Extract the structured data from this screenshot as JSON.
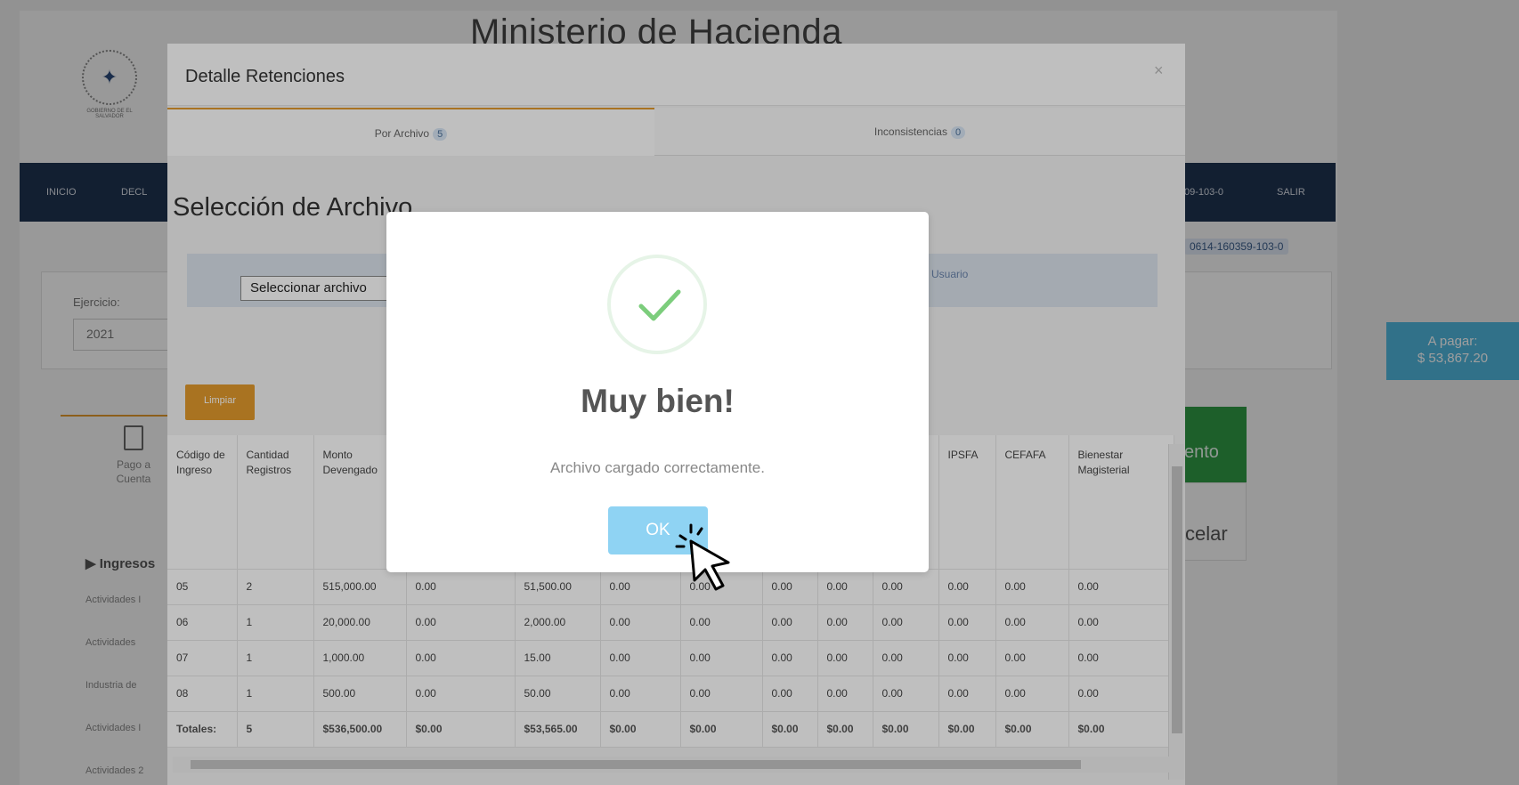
{
  "site": {
    "title": "Ministerio de Hacienda",
    "logo_caption": "GOBIERNO DE EL SALVADOR",
    "nav": [
      "INICIO",
      "DECL",
      "09-103-0",
      "SALIR"
    ],
    "nit_badge": "0614-160359-103-0",
    "ejercicio_label": "Ejercicio:",
    "ejercicio_value": "2021",
    "apagar_label": "A pagar:",
    "apagar_value": "$ 53,867.20",
    "green_btn_text": "ento",
    "cancel_btn_text": "celar",
    "tab_pago_line1": "Pago a",
    "tab_pago_line2": "Cuenta",
    "ingresos_label": "Ingresos",
    "side_rows": [
      "Actividades I",
      "Actividades",
      "Industria de",
      "Actividades I",
      "Actividades 2"
    ]
  },
  "detalle": {
    "title": "Detalle Retenciones",
    "close": "×",
    "tabs": [
      {
        "label": "Por Archivo",
        "count": "5"
      },
      {
        "label": "Inconsistencias",
        "count": "0"
      }
    ],
    "heading": "Selección de Archivo",
    "file_button": "Seleccionar archivo",
    "usuario_label": "Usuario",
    "limpiar": "Limpiar",
    "table": {
      "headers": [
        "Código de Ingreso",
        "Cantidad Registros",
        "Monto Devengado",
        "",
        "",
        "",
        "",
        "",
        "",
        "",
        "IPSFA",
        "CEFAFA",
        "Bienestar Magisterial"
      ],
      "rows": [
        [
          "05",
          "2",
          "515,000.00",
          "0.00",
          "51,500.00",
          "0.00",
          "0.00",
          "0.00",
          "0.00",
          "0.00",
          "0.00",
          "0.00",
          "0.00"
        ],
        [
          "06",
          "1",
          "20,000.00",
          "0.00",
          "2,000.00",
          "0.00",
          "0.00",
          "0.00",
          "0.00",
          "0.00",
          "0.00",
          "0.00",
          "0.00"
        ],
        [
          "07",
          "1",
          "1,000.00",
          "0.00",
          "15.00",
          "0.00",
          "0.00",
          "0.00",
          "0.00",
          "0.00",
          "0.00",
          "0.00",
          "0.00"
        ],
        [
          "08",
          "1",
          "500.00",
          "0.00",
          "50.00",
          "0.00",
          "0.00",
          "0.00",
          "0.00",
          "0.00",
          "0.00",
          "0.00",
          "0.00"
        ]
      ],
      "totals": [
        "Totales:",
        "5",
        "$536,500.00",
        "$0.00",
        "$53,565.00",
        "$0.00",
        "$0.00",
        "$0.00",
        "$0.00",
        "$0.00",
        "$0.00",
        "$0.00",
        "$0.00"
      ]
    }
  },
  "alert": {
    "title": "Muy bien!",
    "message": "Archivo cargado correctamente.",
    "ok": "OK",
    "check_color": "#7ccd7c"
  }
}
